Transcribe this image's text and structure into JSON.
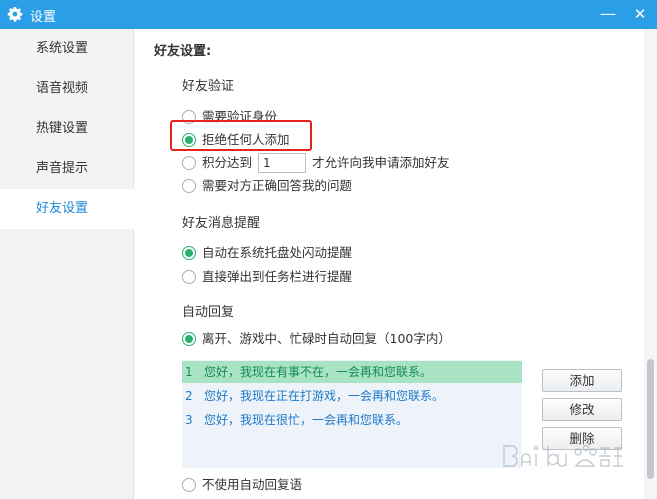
{
  "window": {
    "title": "设置",
    "minimize_glyph": "—",
    "close_glyph": "✕"
  },
  "sidebar": {
    "items": [
      {
        "label": "系统设置",
        "active": false
      },
      {
        "label": "语音视频",
        "active": false
      },
      {
        "label": "热键设置",
        "active": false
      },
      {
        "label": "声音提示",
        "active": false
      },
      {
        "label": "好友设置",
        "active": true
      }
    ]
  },
  "main": {
    "section_title": "好友设置:",
    "verification": {
      "heading": "好友验证",
      "options": [
        {
          "label": "需要验证身份",
          "checked": false
        },
        {
          "label": "拒绝任何人添加",
          "checked": true
        },
        {
          "label": "积分达到",
          "checked": false
        },
        {
          "label": "需要对方正确回答我的问题",
          "checked": false
        }
      ],
      "score_value": "1",
      "score_suffix": "才允许向我申请添加好友"
    },
    "message_alert": {
      "heading": "好友消息提醒",
      "options": [
        {
          "label": "自动在系统托盘处闪动提醒",
          "checked": true
        },
        {
          "label": "直接弹出到任务栏进行提醒",
          "checked": false
        }
      ]
    },
    "auto_reply": {
      "heading": "自动回复",
      "enable_option": {
        "label": "离开、游戏中、忙碌时自动回复（100字内）",
        "checked": true
      },
      "replies": [
        {
          "num": "1",
          "text": "您好，我现在有事不在，一会再和您联系。",
          "selected": true
        },
        {
          "num": "2",
          "text": "您好，我现在正在打游戏，一会再和您联系。",
          "selected": false
        },
        {
          "num": "3",
          "text": "您好，我现在很忙，一会再和您联系。",
          "selected": false
        }
      ],
      "buttons": {
        "add": "添加",
        "edit": "修改",
        "delete": "删除"
      },
      "disable_option": {
        "label": "不使用自动回复语",
        "checked": false
      }
    }
  },
  "watermark": {
    "text": "Baidu 经验"
  },
  "colors": {
    "titlebar": "#2b9ee8",
    "accent_green": "#27b06e",
    "highlight_red": "#e8221d",
    "active_nav_text": "#1e88d6"
  }
}
